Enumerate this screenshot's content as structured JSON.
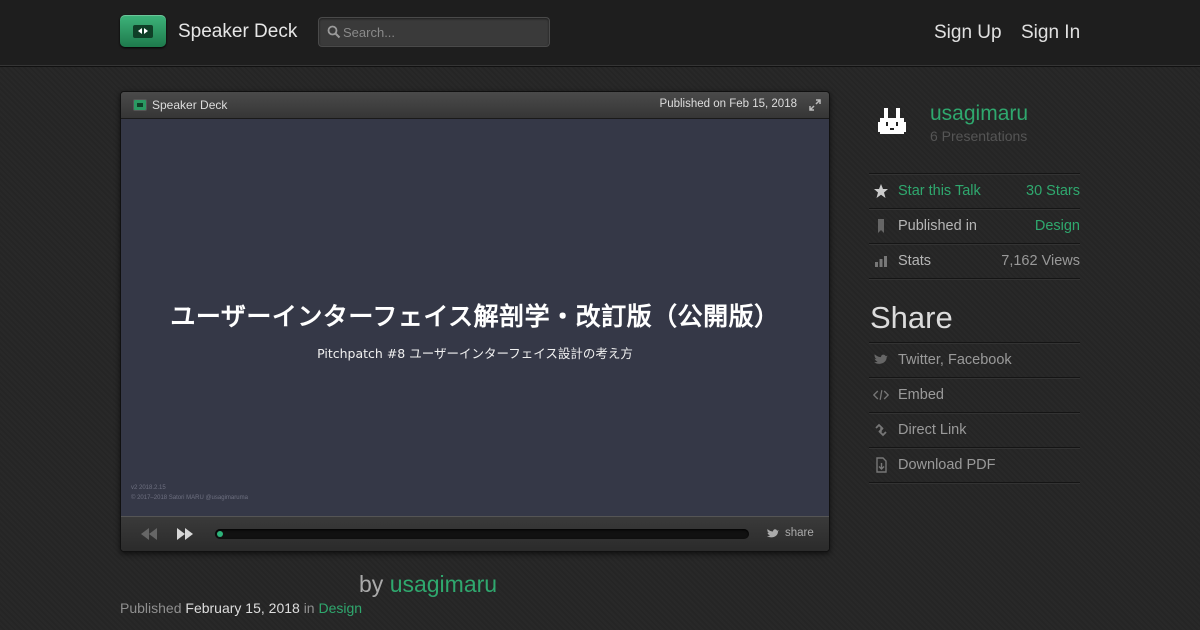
{
  "header": {
    "brand": "Speaker Deck",
    "search_placeholder": "Search...",
    "sign_up": "Sign Up",
    "sign_in": "Sign In"
  },
  "player": {
    "brand": "Speaker Deck",
    "published_on": "Published on Feb 15, 2018",
    "share_label": "share",
    "progress": 0.01,
    "slide": {
      "title": "ユーザーインターフェイス解剖学・改訂版（公開版）",
      "subtitle": "Pitchpatch #8 ユーザーインターフェイス設計の考え方",
      "footer_line1": "v2 2018.2.15",
      "footer_line2": "© 2017–2018 Satori MARU @usagimaruma"
    }
  },
  "details": {
    "by_prefix": "by",
    "author": "usagimaru",
    "published_prefix": "Published",
    "published_date": "February 15, 2018",
    "in_word": "in",
    "category": "Design"
  },
  "sidebar": {
    "author_name": "usagimaru",
    "presentations": "6 Presentations",
    "star_label": "Star this Talk",
    "star_count": "30 Stars",
    "published_in_label": "Published in",
    "published_in_value": "Design",
    "stats_label": "Stats",
    "stats_value": "7,162 Views",
    "share_heading": "Share",
    "share_items": {
      "social": "Twitter, Facebook",
      "embed": "Embed",
      "direct_link": "Direct Link",
      "download_pdf": "Download PDF"
    }
  },
  "colors": {
    "accent_green": "#2fa86e",
    "slide_bg": "#353847",
    "page_bg": "#262626"
  }
}
